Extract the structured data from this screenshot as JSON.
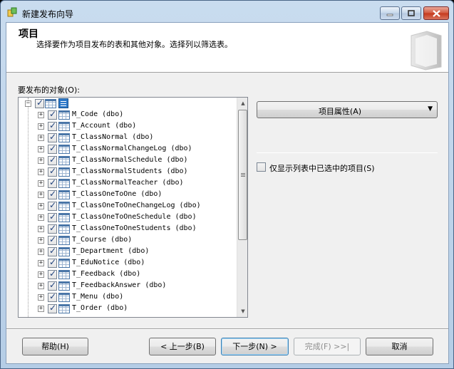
{
  "window": {
    "title": "新建发布向导"
  },
  "header": {
    "title": "项目",
    "description": "选择要作为项目发布的表和其他对象。选择列以筛选表。"
  },
  "objects_label": "要发布的对象(O):",
  "tree": {
    "root_checked": true,
    "items": [
      {
        "label": "M_Code (dbo)",
        "checked": true
      },
      {
        "label": "T_Account (dbo)",
        "checked": true
      },
      {
        "label": "T_ClassNormal (dbo)",
        "checked": true
      },
      {
        "label": "T_ClassNormalChangeLog (dbo)",
        "checked": true
      },
      {
        "label": "T_ClassNormalSchedule (dbo)",
        "checked": true
      },
      {
        "label": "T_ClassNormalStudents (dbo)",
        "checked": true
      },
      {
        "label": "T_ClassNormalTeacher (dbo)",
        "checked": true
      },
      {
        "label": "T_ClassOneToOne (dbo)",
        "checked": true
      },
      {
        "label": "T_ClassOneToOneChangeLog (dbo)",
        "checked": true
      },
      {
        "label": "T_ClassOneToOneSchedule (dbo)",
        "checked": true
      },
      {
        "label": "T_ClassOneToOneStudents (dbo)",
        "checked": true
      },
      {
        "label": "T_Course (dbo)",
        "checked": true
      },
      {
        "label": "T_Department (dbo)",
        "checked": true
      },
      {
        "label": "T_EduNotice (dbo)",
        "checked": true
      },
      {
        "label": "T_Feedback (dbo)",
        "checked": true
      },
      {
        "label": "T_FeedbackAnswer (dbo)",
        "checked": true
      },
      {
        "label": "T_Menu (dbo)",
        "checked": true
      },
      {
        "label": "T_Order (dbo)",
        "checked": true
      }
    ]
  },
  "properties_button": "项目属性(A)",
  "filter_checkbox": {
    "label": "仅显示列表中已选中的项目(S)",
    "checked": false
  },
  "buttons": {
    "help": "帮助(H)",
    "back": "< 上一步(B)",
    "next": "下一步(N) >",
    "finish": "完成(F) >>|",
    "cancel": "取消"
  },
  "colors": {
    "accent": "#3c7fb1",
    "titlebar": "#b5cde6",
    "close": "#c5381c"
  }
}
